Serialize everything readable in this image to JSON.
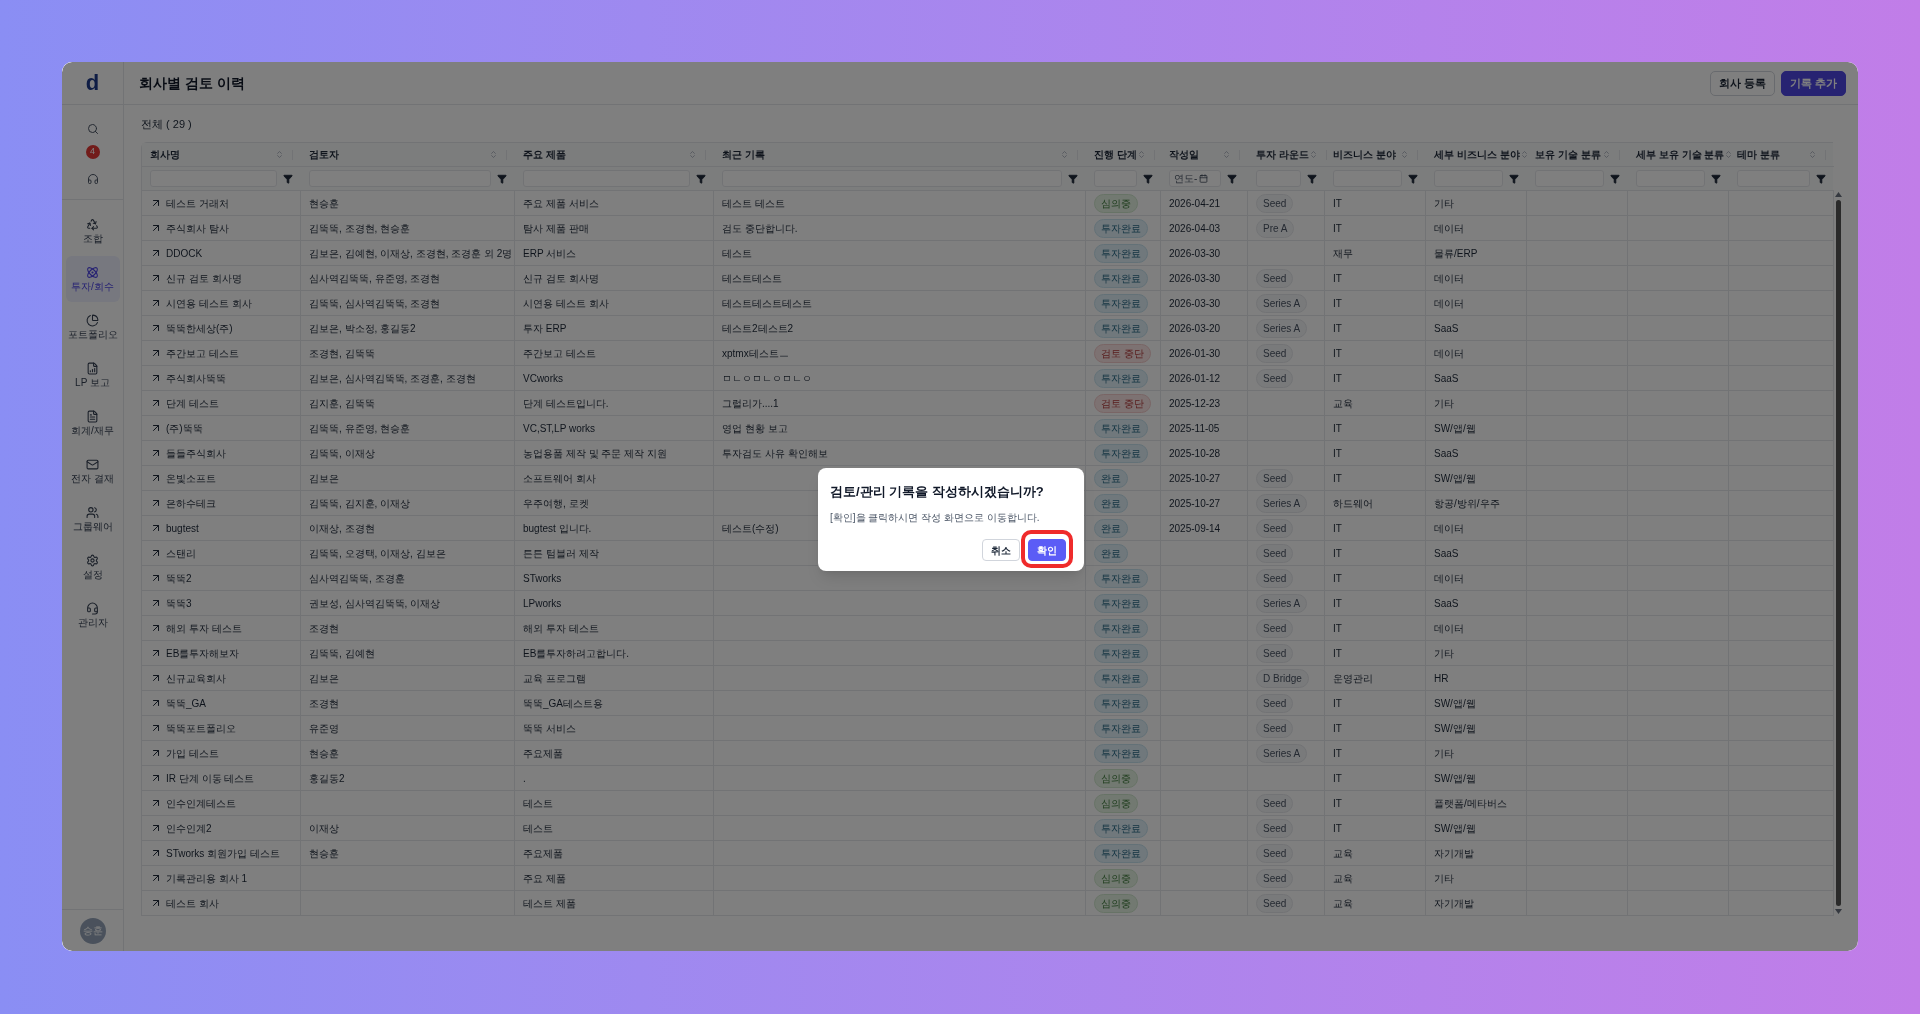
{
  "sidebar": {
    "logo": "d",
    "notification_count": "4",
    "items": [
      {
        "label": "조합",
        "selected": false
      },
      {
        "label": "투자/회수",
        "selected": true
      },
      {
        "label": "포트폴리오",
        "selected": false
      },
      {
        "label": "LP 보고",
        "selected": false
      },
      {
        "label": "회계/재무",
        "selected": false
      },
      {
        "label": "전자 결재",
        "selected": false
      },
      {
        "label": "그룹웨어",
        "selected": false
      },
      {
        "label": "설정",
        "selected": false
      },
      {
        "label": "관리자",
        "selected": false
      }
    ],
    "avatar": "승훈"
  },
  "header": {
    "title": "회사별 검토 이력",
    "buttons": [
      {
        "label": "회사 등록",
        "kind": "outline"
      },
      {
        "label": "기록 추가",
        "kind": "primary"
      }
    ]
  },
  "summary": "전체 ( 29 )",
  "table": {
    "columns": [
      {
        "label": "회사명"
      },
      {
        "label": "검토자"
      },
      {
        "label": "주요 제품"
      },
      {
        "label": "최근 기록"
      },
      {
        "label": "진행 단계"
      },
      {
        "label": "작성일",
        "placeholder": "연도-"
      },
      {
        "label": "투자 라운드"
      },
      {
        "label": "비즈니스 분야"
      },
      {
        "label": "세부 비즈니스 분야"
      },
      {
        "label": "보유 기술 분류"
      },
      {
        "label": "세부 보유 기술 분류"
      },
      {
        "label": "테마 분류"
      }
    ],
    "rows": [
      {
        "company": "테스트 거래처",
        "reviewers": "현승훈",
        "product": "주요 제품 서비스",
        "record": "테스트 테스트",
        "stage": {
          "text": "심의중",
          "kind": "review"
        },
        "date": "2026-04-21",
        "round": "Seed",
        "business": "IT",
        "sub_business": "기타"
      },
      {
        "company": "주식회사 탐사",
        "reviewers": "김뚝뚝, 조경현, 현승훈",
        "product": "탐사 제품 판매",
        "record": "검도 중단합니다.",
        "stage": {
          "text": "투자완료",
          "kind": "invested"
        },
        "date": "2026-04-03",
        "round": "Pre A",
        "business": "IT",
        "sub_business": "데이터"
      },
      {
        "company": "DDOCK",
        "reviewers": "김보은, 김예현, 이재상, 조경현, 조경훈 외 2명",
        "product": "ERP 서비스",
        "record": "테스트",
        "stage": {
          "text": "투자완료",
          "kind": "invested"
        },
        "date": "2026-03-30",
        "business": "재무",
        "sub_business": "물류/ERP"
      },
      {
        "company": "신규 검토 회사명",
        "reviewers": "심사역김뚝뚝, 유준영, 조경현",
        "product": "신규 검토 회사명",
        "record": "테스트테스트",
        "stage": {
          "text": "투자완료",
          "kind": "invested"
        },
        "date": "2026-03-30",
        "round": "Seed",
        "business": "IT",
        "sub_business": "데이터"
      },
      {
        "company": "시연용 테스트 회사",
        "reviewers": "김뚝뚝, 심사역김뚝뚝, 조경현",
        "product": "시연용 테스트 회사",
        "record": "테스트테스트테스트",
        "stage": {
          "text": "투자완료",
          "kind": "invested"
        },
        "date": "2026-03-30",
        "round": "Series A",
        "business": "IT",
        "sub_business": "데이터"
      },
      {
        "company": "뚝뚝한세상(주)",
        "reviewers": "김보은, 박소정, 홍길동2",
        "product": "투자 ERP",
        "record": "테스트2테스트2",
        "stage": {
          "text": "투자완료",
          "kind": "invested"
        },
        "date": "2026-03-20",
        "round": "Series A",
        "business": "IT",
        "sub_business": "SaaS"
      },
      {
        "company": "주간보고 테스트",
        "reviewers": "조경현, 김뚝뚝",
        "product": "주간보고 테스트",
        "record": "xptmx테스트ㅡ",
        "stage": {
          "text": "검토 중단",
          "kind": "stopped"
        },
        "date": "2026-01-30",
        "round": "Seed",
        "business": "IT",
        "sub_business": "데이터"
      },
      {
        "company": "주식회사뚝뚝",
        "reviewers": "김보은, 심사역김뚝뚝, 조경훈, 조경현",
        "product": "VCworks",
        "record": "ㅁㄴㅇㅁㄴㅇㅁㄴㅇ",
        "stage": {
          "text": "투자완료",
          "kind": "invested"
        },
        "date": "2026-01-12",
        "round": "Seed",
        "business": "IT",
        "sub_business": "SaaS"
      },
      {
        "company": "단계 테스트",
        "reviewers": "김지훈, 김뚝뚝",
        "product": "단계 테스트입니다.",
        "record": "그럴리가....1",
        "stage": {
          "text": "검토 중단",
          "kind": "stopped"
        },
        "date": "2025-12-23",
        "business": "교육",
        "sub_business": "기타"
      },
      {
        "company": "(주)뚝뚝",
        "reviewers": "김뚝뚝, 유준영, 현승훈",
        "product": "VC,ST,LP works",
        "record": "영업 현황 보고",
        "stage": {
          "text": "투자완료",
          "kind": "invested"
        },
        "date": "2025-11-05",
        "business": "IT",
        "sub_business": "SW/앱/웹"
      },
      {
        "company": "들들주식회사",
        "reviewers": "김뚝뚝, 이재상",
        "product": "농업용품 제작 및 주문 제작 지원",
        "record": "투자검도 사유 확인해보",
        "stage": {
          "text": "투자완료",
          "kind": "invested"
        },
        "date": "2025-10-28",
        "business": "IT",
        "sub_business": "SaaS"
      },
      {
        "company": "온빛소프트",
        "reviewers": "김보은",
        "product": "소프트웨어 회사",
        "stage": {
          "text": "완료",
          "kind": "invested"
        },
        "date": "2025-10-27",
        "round": "Seed",
        "business": "IT",
        "sub_business": "SW/앱/웹"
      },
      {
        "company": "은하수테크",
        "reviewers": "김뚝뚝, 김지훈, 이재상",
        "product": "우주여행, 로켓",
        "stage": {
          "text": "완료",
          "kind": "invested"
        },
        "date": "2025-10-27",
        "round": "Series A",
        "business": "하드웨어",
        "sub_business": "항공/방위/우주"
      },
      {
        "company": "bugtest",
        "reviewers": "이재상, 조경현",
        "product": "bugtest 입니다.",
        "record": "테스트(수정)",
        "stage": {
          "text": "완료",
          "kind": "invested"
        },
        "date": "2025-09-14",
        "round": "Seed",
        "business": "IT",
        "sub_business": "데이터"
      },
      {
        "company": "스탠리",
        "reviewers": "김뚝뚝, 오경택, 이재상, 김보은",
        "product": "튼튼 텀블러 제작",
        "stage": {
          "text": "완료",
          "kind": "invested"
        },
        "round": "Seed",
        "business": "IT",
        "sub_business": "SaaS"
      },
      {
        "company": "뚝뚝2",
        "reviewers": "심사역김뚝뚝, 조경훈",
        "product": "STworks",
        "stage": {
          "text": "투자완료",
          "kind": "invested"
        },
        "round": "Seed",
        "business": "IT",
        "sub_business": "데이터"
      },
      {
        "company": "뚝뚝3",
        "reviewers": "권보성, 심사역김뚝뚝, 이재상",
        "product": "LPworks",
        "stage": {
          "text": "투자완료",
          "kind": "invested"
        },
        "round": "Series A",
        "business": "IT",
        "sub_business": "SaaS"
      },
      {
        "company": "해외 투자 테스트",
        "reviewers": "조경현",
        "product": "해외 투자 테스트",
        "stage": {
          "text": "투자완료",
          "kind": "invested"
        },
        "round": "Seed",
        "business": "IT",
        "sub_business": "데이터"
      },
      {
        "company": "EB를투자해보자",
        "reviewers": "김뚝뚝, 김예현",
        "product": "EB를투자하려고합니다.",
        "stage": {
          "text": "투자완료",
          "kind": "invested"
        },
        "round": "Seed",
        "business": "IT",
        "sub_business": "기타"
      },
      {
        "company": "신규교육회사",
        "reviewers": "김보은",
        "product": "교육 프로그램",
        "stage": {
          "text": "투자완료",
          "kind": "invested"
        },
        "round": "D Bridge",
        "business": "운영관리",
        "sub_business": "HR"
      },
      {
        "company": "뚝뚝_GA",
        "reviewers": "조경현",
        "product": "뚝뚝_GA테스트용",
        "stage": {
          "text": "투자완료",
          "kind": "invested"
        },
        "round": "Seed",
        "business": "IT",
        "sub_business": "SW/앱/웹"
      },
      {
        "company": "뚝뚝포트폴리오",
        "reviewers": "유준영",
        "product": "뚝뚝 서비스",
        "stage": {
          "text": "투자완료",
          "kind": "invested"
        },
        "round": "Seed",
        "business": "IT",
        "sub_business": "SW/앱/웹"
      },
      {
        "company": "가입 테스트",
        "reviewers": "현승훈",
        "product": "주요제품",
        "stage": {
          "text": "투자완료",
          "kind": "invested"
        },
        "round": "Series A",
        "business": "IT",
        "sub_business": "기타"
      },
      {
        "company": "IR 단계 이동 테스트",
        "reviewers": "홍길동2",
        "product": ".",
        "stage": {
          "text": "심의중",
          "kind": "review"
        },
        "business": "IT",
        "sub_business": "SW/앱/웹"
      },
      {
        "company": "인수인계테스트",
        "product": "테스트",
        "stage": {
          "text": "심의중",
          "kind": "review"
        },
        "round": "Seed",
        "business": "IT",
        "sub_business": "플랫폼/메타버스"
      },
      {
        "company": "인수인계2",
        "reviewers": "이재상",
        "product": "테스트",
        "stage": {
          "text": "투자완료",
          "kind": "invested"
        },
        "round": "Seed",
        "business": "IT",
        "sub_business": "SW/앱/웹"
      },
      {
        "company": "STworks 회원가입 테스트",
        "reviewers": "현승훈",
        "product": "주요제품",
        "stage": {
          "text": "투자완료",
          "kind": "invested"
        },
        "round": "Seed",
        "business": "교육",
        "sub_business": "자기개발"
      },
      {
        "company": "기록관리용 회사 1",
        "product": "주요 제품",
        "stage": {
          "text": "심의중",
          "kind": "review"
        },
        "round": "Seed",
        "business": "교육",
        "sub_business": "기타"
      },
      {
        "company": "테스트 회사",
        "product": "테스트 제품",
        "stage": {
          "text": "심의중",
          "kind": "review"
        },
        "round": "Seed",
        "business": "교육",
        "sub_business": "자기개발"
      }
    ]
  },
  "dialog": {
    "title": "검토/관리 기록을 작성하시겠습니까?",
    "message": "[확인]을 클릭하시면 작성 화면으로 이동합니다.",
    "buttons": [
      {
        "label": "취소",
        "kind": "cancel",
        "highlighted": false
      },
      {
        "label": "확인",
        "kind": "confirm",
        "highlighted": true
      }
    ]
  }
}
